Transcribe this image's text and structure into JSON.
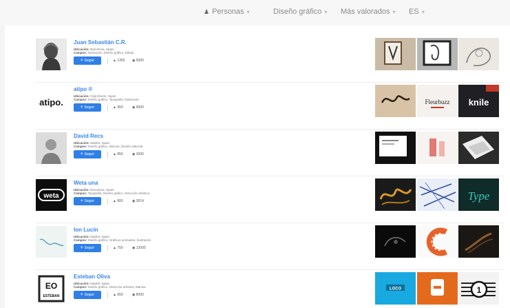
{
  "nav": {
    "people": "Personas",
    "discipline": "Diseño gráfico",
    "sort": "Más valorados",
    "language": "ES"
  },
  "labels": {
    "location": "Ubicación:",
    "fields": "Campos:",
    "follow": "Seguir"
  },
  "profiles": [
    {
      "name": "Juan Sebastián C.R.",
      "location": "Barcelona, Spain",
      "fields": "Ilustración, Diseño gráfico, Dibujo",
      "appreciations": "1350",
      "views": "5000"
    },
    {
      "name": "atipo ®",
      "location": "Gijón/Xixón, Spain",
      "fields": "Diseño gráfico, Tipografía, Ilustración",
      "appreciations": "950",
      "views": "9000"
    },
    {
      "name": "David Recs",
      "location": "Madrid, Spain",
      "fields": "Diseño gráfico, Marcas, Diseño editorial",
      "appreciations": "850",
      "views": "3000"
    },
    {
      "name": "Weta una",
      "location": "Barcelona, Spain",
      "fields": "Tipografía, Diseño gráfico, Dirección artística",
      "appreciations": "800",
      "views": "3014"
    },
    {
      "name": "Ion Lucín",
      "location": "Madrid, Spain",
      "fields": "Diseño gráfico, Gráficos animados, Ilustración",
      "appreciations": "750",
      "views": "12000"
    },
    {
      "name": "Esteban Oliva",
      "location": "Madrid, Spain",
      "fields": "Diseño gráfico, Dirección artística, Marcas",
      "appreciations": "650",
      "views": "8000"
    }
  ],
  "logos": {
    "atipo": "atipo.",
    "weta": "weta",
    "eo_top": "EO",
    "eo_bottom": "ESTEBAN"
  },
  "thumb_text": {
    "fleur": "Fleurbuzz",
    "knile": "knile",
    "typo": "Type",
    "loco": "LOCO",
    "one": "1"
  }
}
